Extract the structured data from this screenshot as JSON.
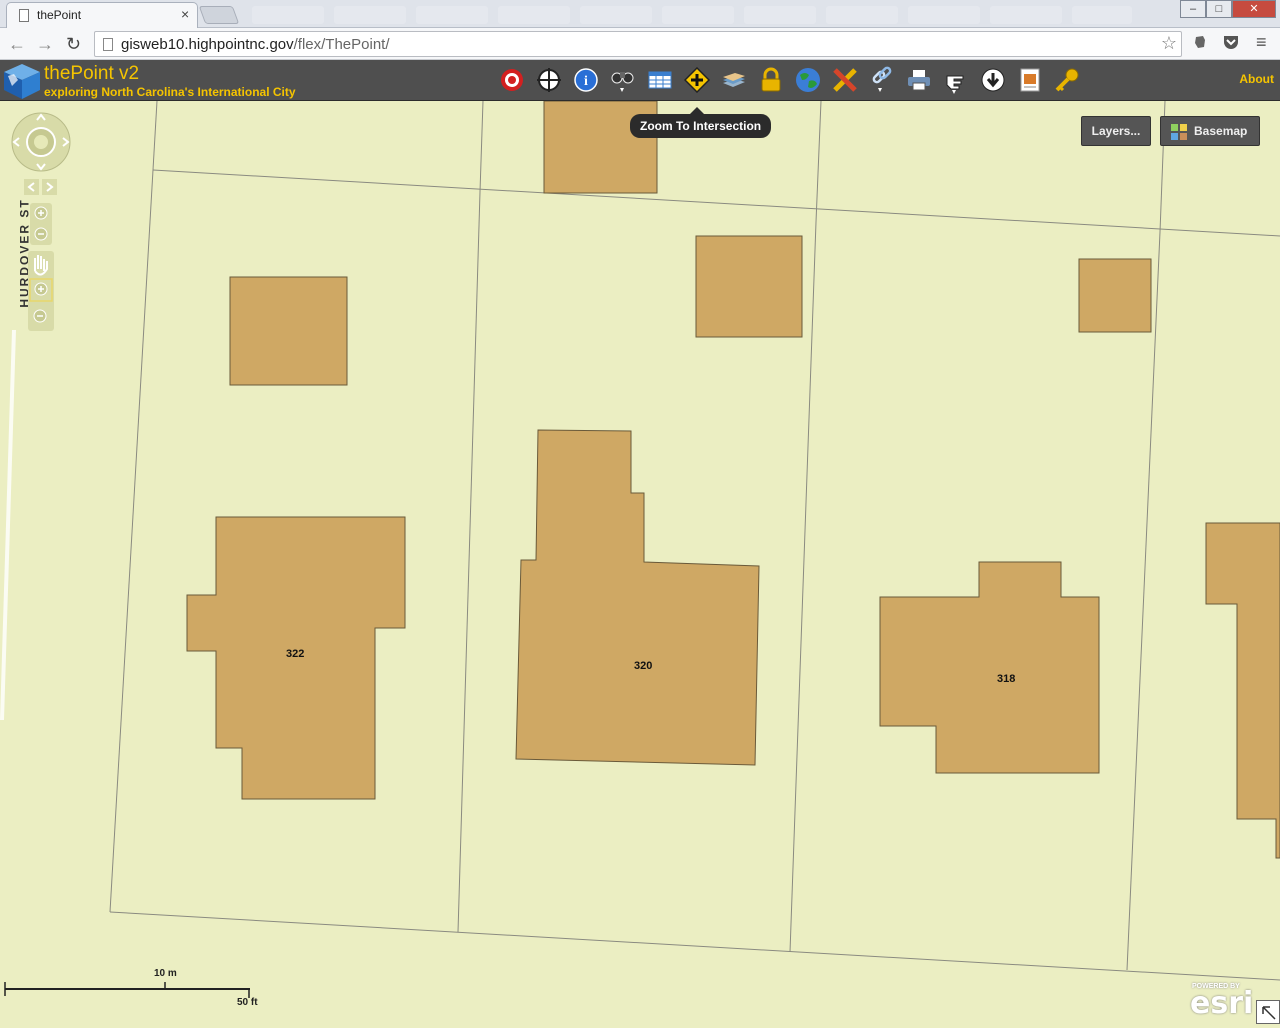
{
  "browser": {
    "tab_title": "thePoint",
    "tab_close": "×",
    "url_host": "gisweb10.highpointnc.gov",
    "url_path": "/flex/ThePoint/",
    "back": "←",
    "forward": "→",
    "reload": "↻",
    "star": "☆",
    "menu": "≡",
    "win_min": "–",
    "win_max": "□",
    "win_close": "✕"
  },
  "app": {
    "title": "thePoint v2",
    "subtitle": "exploring North Carolina's International City",
    "about": "About",
    "tooltip": "Zoom To Intersection"
  },
  "tools": [
    {
      "name": "target-icon",
      "color": "#d32020"
    },
    {
      "name": "crosshair-icon",
      "color": "#222222"
    },
    {
      "name": "info-icon",
      "color": "#2a6fd6"
    },
    {
      "name": "binoculars-icon",
      "color": "#333333"
    },
    {
      "name": "table-icon",
      "color": "#3a7fcf"
    },
    {
      "name": "zoom-intersection-icon",
      "color": "#f5c400"
    },
    {
      "name": "layers-stack-icon",
      "color": "#6a9cc9"
    },
    {
      "name": "lock-icon",
      "color": "#e8b400"
    },
    {
      "name": "globe-icon",
      "color": "#2a9a3a"
    },
    {
      "name": "draw-tools-icon",
      "color": "#d6452a"
    },
    {
      "name": "link-icon",
      "color": "#8fb9e6"
    },
    {
      "name": "print-icon",
      "color": "#6f8fb5"
    },
    {
      "name": "pointer-hand-icon",
      "color": "#ffffff"
    },
    {
      "name": "download-icon",
      "color": "#ffffff"
    },
    {
      "name": "report-icon",
      "color": "#d97b2a"
    },
    {
      "name": "key-icon",
      "color": "#e8b400"
    }
  ],
  "map": {
    "layers_label": "Layers...",
    "basemap_label": "Basemap",
    "street_label": "HURDOVER ST",
    "parcels": [
      {
        "address": "322"
      },
      {
        "address": "320"
      },
      {
        "address": "318"
      }
    ],
    "scale": {
      "metric": "10 m",
      "imperial": "50 ft"
    },
    "attribution_small": "POWERED BY",
    "attribution_brand": "esri",
    "colors": {
      "land": "#ebeec2",
      "building": "#cfa864",
      "line": "#7a7a70"
    }
  }
}
